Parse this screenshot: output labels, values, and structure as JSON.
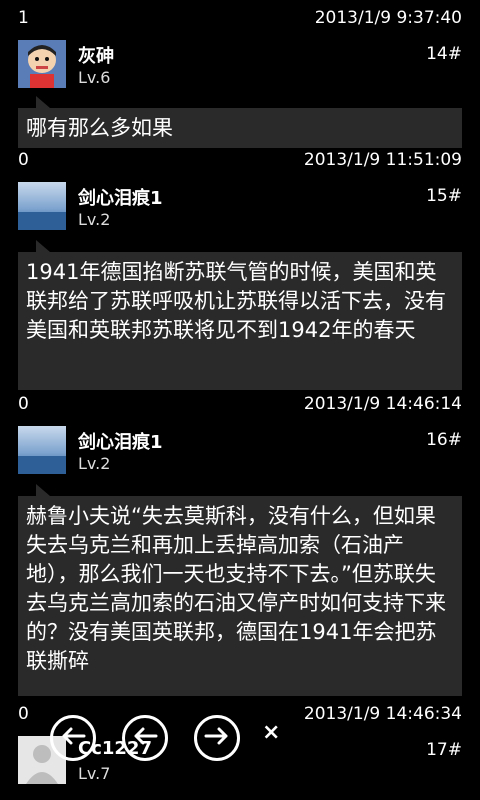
{
  "posts": [
    {
      "reply_count": "1",
      "time": "2013/1/9 9:37:40",
      "username": "灰砷",
      "level": "Lv.6",
      "floor": "14#",
      "content": "哪有那么多如果"
    },
    {
      "reply_count": "0",
      "time": "2013/1/9 11:51:09",
      "username": "剑心泪痕1",
      "level": "Lv.2",
      "floor": "15#",
      "content": "1941年德国掐断苏联气管的时候，美国和英联邦给了苏联呼吸机让苏联得以活下去，没有美国和英联邦苏联将见不到1942年的春天"
    },
    {
      "reply_count": "0",
      "time": "2013/1/9 14:46:14",
      "username": "剑心泪痕1",
      "level": "Lv.2",
      "floor": "16#",
      "content": "赫鲁小夫说“失去莫斯科，没有什么，但如果失去乌克兰和再加上丢掉高加索（石油产地），那么我们一天也支持不下去。”但苏联失去乌克兰高加索的石油又停产时如何支持下来的？没有美国英联邦，德国在1941年会把苏联撕碎"
    },
    {
      "reply_count": "0",
      "time": "2013/1/9 14:46:34",
      "username": "Cc1227",
      "level": "Lv.7",
      "floor": "17#",
      "content": ""
    }
  ],
  "appbar": {
    "close_glyph": "×"
  }
}
